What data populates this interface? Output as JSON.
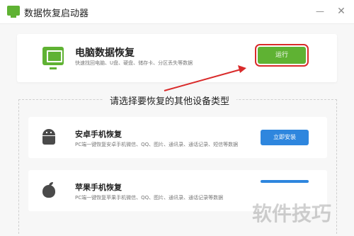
{
  "window": {
    "title": "数据恢复启动器",
    "minimize_glyph": "—",
    "close_glyph": "✕"
  },
  "main_card": {
    "icon": "monitor-icon",
    "title": "电脑数据恢复",
    "description": "快速找回电脑、U盘、硬盘、储存卡、分区丢失等数据",
    "run_button": "运行",
    "accent_color": "#5fb233"
  },
  "section": {
    "title": "请选择要恢复的其他设备类型"
  },
  "devices": [
    {
      "icon": "android-icon",
      "title": "安卓手机恢复",
      "description": "PC端一键恢复安卓手机微信、QQ、图片、通讯录、通话记录、短信等数据",
      "button": "立即安装",
      "button_color": "#2e86de"
    },
    {
      "icon": "apple-icon",
      "title": "苹果手机恢复",
      "description": "PC端一键恢复苹果手机微信、QQ、图片、通讯录、通话记录等数据"
    }
  ],
  "watermark": "软件技巧",
  "annotation_color": "#d92a2a"
}
